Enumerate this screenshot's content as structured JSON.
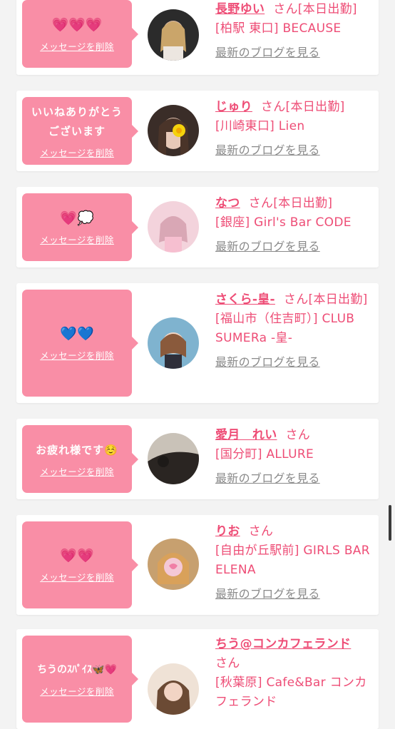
{
  "delete_label": "メッセージを削除",
  "blog_label": "最新のブログを見る",
  "entries": [
    {
      "message": "💗💗💗",
      "name": "長野ゆい",
      "suffix": "さん[本日出勤]",
      "shop": "[柏駅 東口] BECAUSE"
    },
    {
      "message": "いいねありがとうございます",
      "name": "じゅり",
      "suffix": "さん[本日出勤]",
      "shop": "[川崎東口] Lien"
    },
    {
      "message": "💗💭",
      "name": "なつ",
      "suffix": "さん[本日出勤]",
      "shop": "[銀座] Girl's Bar CODE"
    },
    {
      "message": "💙💙",
      "name": "さくら-皇-",
      "suffix": "さん[本日出勤]",
      "shop": "[福山市（住吉町）] CLUB SUMERa -皇-"
    },
    {
      "message": "お疲れ様です☺️",
      "name": "愛月　れい",
      "suffix": "さん",
      "shop": "[国分町] ALLURE"
    },
    {
      "message": "💗💗",
      "name": "りお",
      "suffix": "さん",
      "shop": "[自由が丘駅前] GIRLS BAR ELENA"
    },
    {
      "message": "ちうのｽﾊﾟｲｽ🦋💗",
      "name": "ちう@コンカフェランド",
      "suffix": "さん",
      "shop": "[秋葉原] Cafe&Bar コンカフェランド"
    }
  ]
}
